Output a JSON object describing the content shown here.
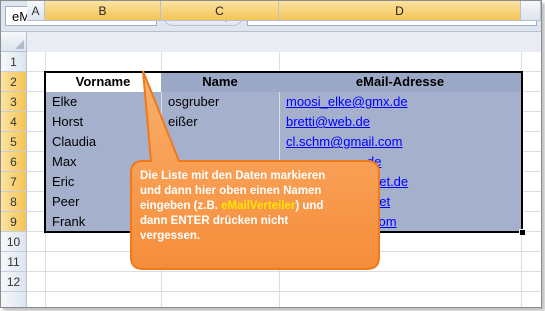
{
  "formula_bar": {
    "name_box": "eMailVerteiler",
    "fx_label": "fx",
    "content": "Vorname"
  },
  "columns": [
    "A",
    "B",
    "C",
    "D"
  ],
  "rows": [
    "1",
    "2",
    "3",
    "4",
    "5",
    "6",
    "7",
    "8",
    "9",
    "10",
    "11",
    "12"
  ],
  "table": {
    "headers": [
      "Vorname",
      "Name",
      "eMail-Adresse"
    ],
    "rows": [
      {
        "vorname": "Elke",
        "name": "osgruber",
        "email": "moosi_elke@gmx.de"
      },
      {
        "vorname": "Horst",
        "name": "eißer",
        "email": "bretti@web.de"
      },
      {
        "vorname": "Claudia",
        "name": "",
        "email": "cl.schm@gmail.com"
      },
      {
        "vorname": "Max",
        "name": "",
        "email": "de"
      },
      {
        "vorname": "Eric",
        "name": "",
        "email": "net.de"
      },
      {
        "vorname": "Peer",
        "name": "",
        "email": "net"
      },
      {
        "vorname": "Frank",
        "name": "",
        "email": "com"
      }
    ]
  },
  "callout": {
    "line1": "Die Liste mit den Daten markieren",
    "line2": "und dann hier oben einen Namen",
    "line3_a": "eingeben (z.B. ",
    "line3_hl": "eMailVerteiler",
    "line3_b": ") und",
    "line4": "dann ENTER drücken nicht",
    "line5": "vergessen."
  },
  "colors": {
    "selection_header": "#f4c456",
    "table_fill": "#a5b0cd",
    "callout_fill": "#f7a25a",
    "callout_border": "#f07a1e",
    "highlight_text": "#ffe400"
  }
}
